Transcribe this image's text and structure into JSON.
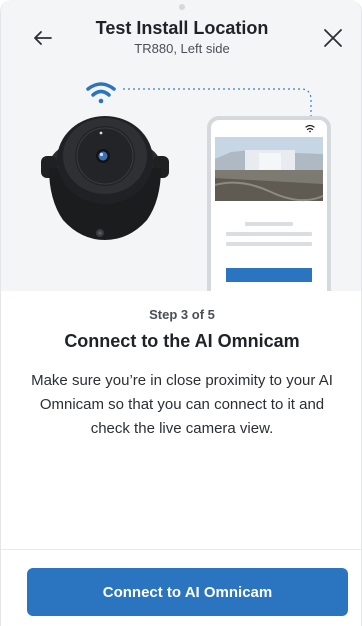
{
  "header": {
    "title": "Test Install Location",
    "subtitle": "TR880, Left side",
    "back_icon": "arrow-left-icon",
    "close_icon": "close-icon"
  },
  "illustration": {
    "icons": [
      "wifi-icon",
      "camera-icon",
      "phone-icon"
    ]
  },
  "content": {
    "step": "Step 3 of 5",
    "heading": "Connect to the AI Omnicam",
    "body": "Make sure you’re in close proximity to your AI Omnicam so that you can connect to it and check the live camera view."
  },
  "footer": {
    "cta_label": "Connect to AI Omnicam"
  },
  "colors": {
    "accent": "#2b74c0",
    "hero_bg": "#f4f5f6",
    "camera": "#1b1c1e"
  }
}
